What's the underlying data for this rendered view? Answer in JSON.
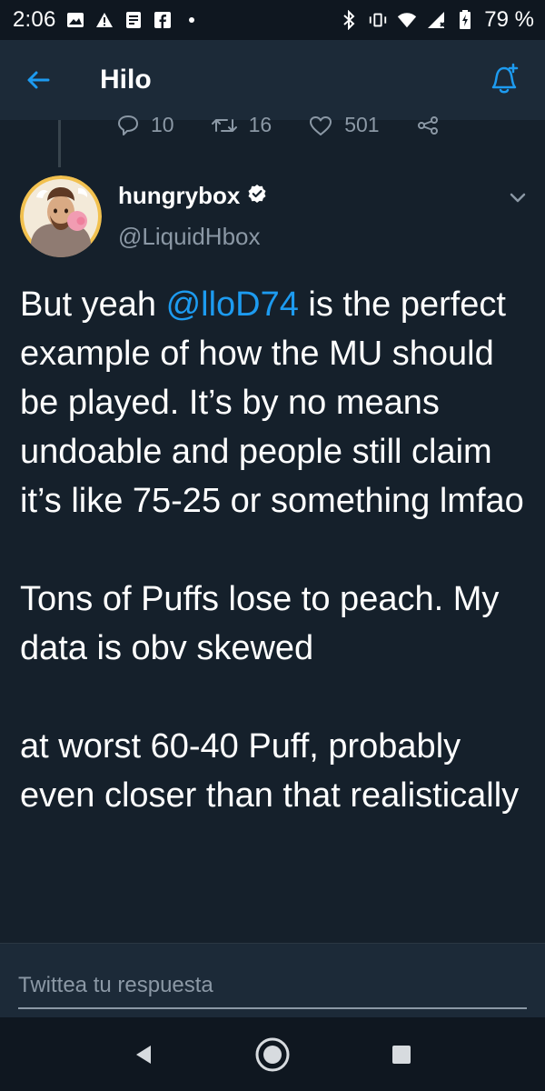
{
  "status_bar": {
    "time": "2:06",
    "battery": "79 %"
  },
  "app_bar": {
    "title": "Hilo"
  },
  "previous_tweet": {
    "replies": "10",
    "retweets": "16",
    "likes": "501"
  },
  "tweet": {
    "display_name": "hungrybox",
    "handle": "@LiquidHbox",
    "paragraph_1_prefix": "But yeah ",
    "mention": "@lloD74",
    "paragraph_1_suffix": " is the perfect example of how the MU should be played. It’s by no means undoable and people still claim it’s like 75-25 or something lmfao",
    "paragraph_2": "Tons of Puffs lose to peach. My data is obv skewed",
    "paragraph_3": "at worst 60-40 Puff, probably even closer than that realistically"
  },
  "reply": {
    "placeholder": "Twittea tu respuesta"
  },
  "colors": {
    "background": "#15202b",
    "accent": "#1d9bf0",
    "muted": "#8b98a5"
  }
}
